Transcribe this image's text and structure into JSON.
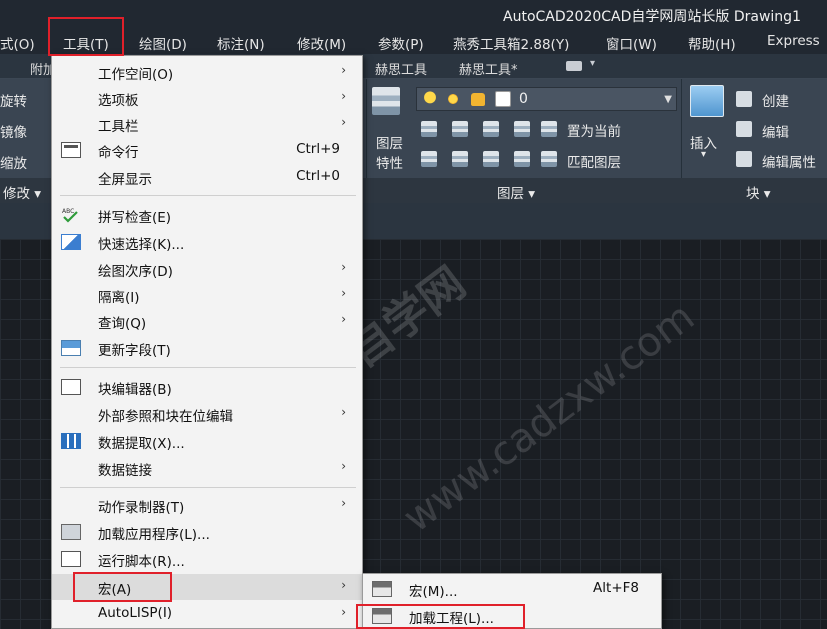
{
  "app": {
    "title": "AutoCAD2020CAD自学网周站长版   Drawing1"
  },
  "menubar": {
    "items": [
      "式(O)",
      "工具(T)",
      "绘图(D)",
      "标注(N)",
      "修改(M)",
      "参数(P)",
      "燕秀工具箱2.88(Y)",
      "窗口(W)",
      "帮助(H)",
      "Express"
    ]
  },
  "ribbon_tabs": {
    "items": [
      "附加",
      "赫思工具",
      "赫思工具*"
    ]
  },
  "ribbon": {
    "modify_labels": [
      "旋转",
      "镜像",
      "缩放"
    ],
    "modify_panel": "修改 ▾",
    "layer_big_label_line1": "图层",
    "layer_big_label_line2": "特性",
    "layer_current_value": "0",
    "set_current": "置为当前",
    "match_layer": "匹配图层",
    "layer_panel": "图层 ▾",
    "insert_label": "插入",
    "create": "创建",
    "edit": "编辑",
    "edit_attr": "编辑属性",
    "block_panel": "块 ▾"
  },
  "tools_menu": {
    "items": [
      {
        "label": "工作空间(O)",
        "shortcut": "",
        "arrow": "›",
        "icon": ""
      },
      {
        "label": "选项板",
        "shortcut": "",
        "arrow": "›",
        "icon": ""
      },
      {
        "label": "工具栏",
        "shortcut": "",
        "arrow": "›",
        "icon": ""
      },
      {
        "label": "命令行",
        "shortcut": "Ctrl+9",
        "arrow": "",
        "icon": "command-line-icon"
      },
      {
        "label": "全屏显示",
        "shortcut": "Ctrl+0",
        "arrow": "",
        "icon": ""
      },
      {
        "label": "拼写检查(E)",
        "shortcut": "",
        "arrow": "",
        "icon": "spell-check-icon"
      },
      {
        "label": "快速选择(K)...",
        "shortcut": "",
        "arrow": "",
        "icon": "quick-select-icon"
      },
      {
        "label": "绘图次序(D)",
        "shortcut": "",
        "arrow": "›",
        "icon": ""
      },
      {
        "label": "隔离(I)",
        "shortcut": "",
        "arrow": "›",
        "icon": ""
      },
      {
        "label": "查询(Q)",
        "shortcut": "",
        "arrow": "›",
        "icon": ""
      },
      {
        "label": "更新字段(T)",
        "shortcut": "",
        "arrow": "",
        "icon": "update-field-icon"
      },
      {
        "label": "块编辑器(B)",
        "shortcut": "",
        "arrow": "",
        "icon": "block-editor-icon"
      },
      {
        "label": "外部参照和块在位编辑",
        "shortcut": "",
        "arrow": "›",
        "icon": ""
      },
      {
        "label": "数据提取(X)...",
        "shortcut": "",
        "arrow": "",
        "icon": "data-extraction-icon"
      },
      {
        "label": "数据链接",
        "shortcut": "",
        "arrow": "›",
        "icon": ""
      },
      {
        "label": "动作录制器(T)",
        "shortcut": "",
        "arrow": "›",
        "icon": ""
      },
      {
        "label": "加载应用程序(L)...",
        "shortcut": "",
        "arrow": "",
        "icon": "load-application-icon"
      },
      {
        "label": "运行脚本(R)...",
        "shortcut": "",
        "arrow": "",
        "icon": "run-script-icon"
      },
      {
        "label": "宏(A)",
        "shortcut": "",
        "arrow": "›",
        "icon": ""
      },
      {
        "label": "AutoLISP(I)",
        "shortcut": "",
        "arrow": "›",
        "icon": ""
      }
    ]
  },
  "macro_submenu": {
    "items": [
      {
        "label": "宏(M)...",
        "shortcut": "Alt+F8",
        "icon": "vba-macro-icon"
      },
      {
        "label": "加载工程(L)...",
        "shortcut": "",
        "icon": "vba-load-project-icon"
      }
    ]
  },
  "watermark": {
    "line1": "CAD自学网",
    "line2": "www.cadzxw.com"
  }
}
